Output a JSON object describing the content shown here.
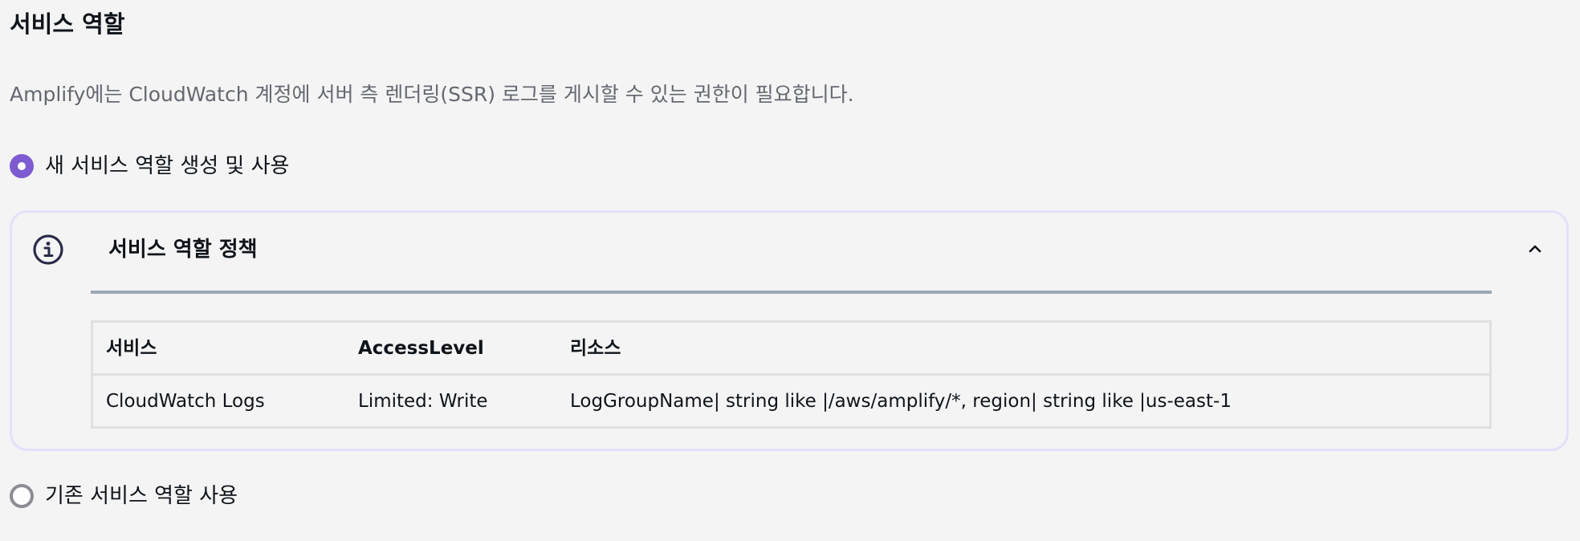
{
  "section": {
    "title": "서비스 역할",
    "description": "Amplify에는 CloudWatch 계정에 서버 측 렌더링(SSR) 로그를 게시할 수 있는 권한이 필요합니다."
  },
  "options": [
    {
      "label": "새 서비스 역할 생성 및 사용",
      "selected": true
    },
    {
      "label": "기존 서비스 역할 사용",
      "selected": false
    }
  ],
  "policy_panel": {
    "icon": "info-icon",
    "title": "서비스 역할 정책",
    "expanded": true,
    "toggle_icon": "chevron-up-icon",
    "table": {
      "headers": [
        "서비스",
        "AccessLevel",
        "리소스"
      ],
      "rows": [
        [
          "CloudWatch Logs",
          "Limited: Write",
          "LogGroupName| string like |/aws/amplify/*, region| string like |us-east-1"
        ]
      ]
    }
  },
  "colors": {
    "accent": "#7d5bd0",
    "panel_border": "#e4e0fb",
    "divider": "#9ba7b6",
    "background": "#f4f4f4",
    "muted_text": "#656871"
  }
}
